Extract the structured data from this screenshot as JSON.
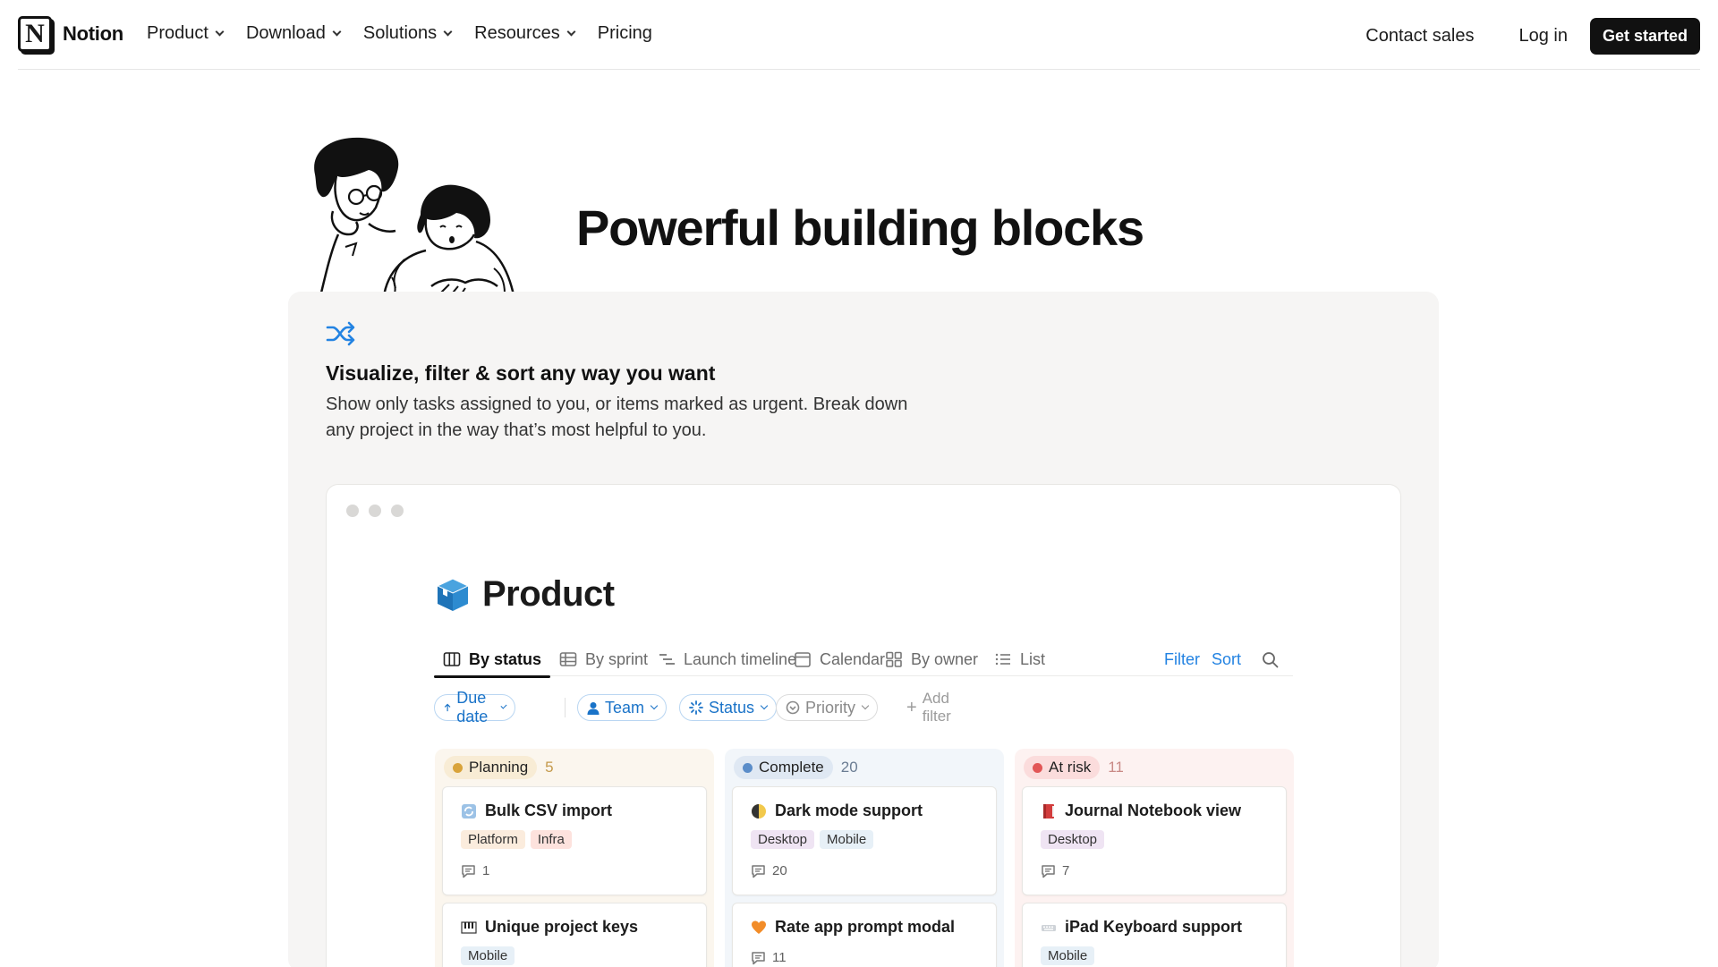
{
  "nav": {
    "logo_text": "Notion",
    "logo_glyph": "N",
    "links": [
      "Product",
      "Download",
      "Solutions",
      "Resources",
      "Pricing"
    ],
    "contact_sales": "Contact sales",
    "login": "Log in",
    "get_started": "Get started"
  },
  "hero": {
    "title": "Powerful building blocks"
  },
  "feature": {
    "icon": "shuffle-icon",
    "title": "Visualize, filter & sort any way you want",
    "description": "Show only tasks assigned to you, or items marked as urgent. Break down any project in the way that’s most helpful to you."
  },
  "app": {
    "db_icon": "cube-icon",
    "db_title": "Product",
    "tabs": [
      "By status",
      "By sprint",
      "Launch timeline",
      "Calendar",
      "By owner",
      "List"
    ],
    "active_tab": "By status",
    "filter_label": "Filter",
    "sort_label": "Sort",
    "filters": {
      "due_date": "Due date",
      "team": "Team",
      "status": "Status",
      "priority": "Priority",
      "add_filter": "Add filter"
    },
    "columns": [
      {
        "name": "Planning",
        "count": "5",
        "color": "#d9a33a",
        "pill_bg": "#f8ecd5",
        "bg": "#fbf6ee",
        "count_color": "#c49a4c",
        "cards": [
          {
            "icon": "sync-icon",
            "title": "Bulk CSV import",
            "tags": [
              {
                "label": "Platform",
                "bg": "#fbecdd"
              },
              {
                "label": "Infra",
                "bg": "#fde2dd"
              }
            ],
            "comments": "1"
          },
          {
            "icon": "piano-icon",
            "title": "Unique project keys",
            "tags": [
              {
                "label": "Mobile",
                "bg": "#e7f0f7"
              }
            ],
            "comments": ""
          }
        ]
      },
      {
        "name": "Complete",
        "count": "20",
        "color": "#5b8dc9",
        "pill_bg": "#dfe8f3",
        "bg": "#f2f6fa",
        "count_color": "#6b7d93",
        "cards": [
          {
            "icon": "half-moon-icon",
            "title": "Dark mode support",
            "tags": [
              {
                "label": "Desktop",
                "bg": "#efe4f3"
              },
              {
                "label": "Mobile",
                "bg": "#e7f0f7"
              }
            ],
            "comments": "20"
          },
          {
            "icon": "heart-icon",
            "title": "Rate app prompt modal",
            "tags": [],
            "comments": "11"
          }
        ]
      },
      {
        "name": "At risk",
        "count": "11",
        "color": "#e25656",
        "pill_bg": "#fbdcdc",
        "bg": "#fdf2f1",
        "count_color": "#c98a86",
        "cards": [
          {
            "icon": "book-icon",
            "title": "Journal Notebook view",
            "tags": [
              {
                "label": "Desktop",
                "bg": "#efe4f3"
              }
            ],
            "comments": "7"
          },
          {
            "icon": "keyboard-icon",
            "title": "iPad Keyboard support",
            "tags": [
              {
                "label": "Mobile",
                "bg": "#e7f0f7"
              }
            ],
            "comments": ""
          }
        ]
      }
    ]
  }
}
